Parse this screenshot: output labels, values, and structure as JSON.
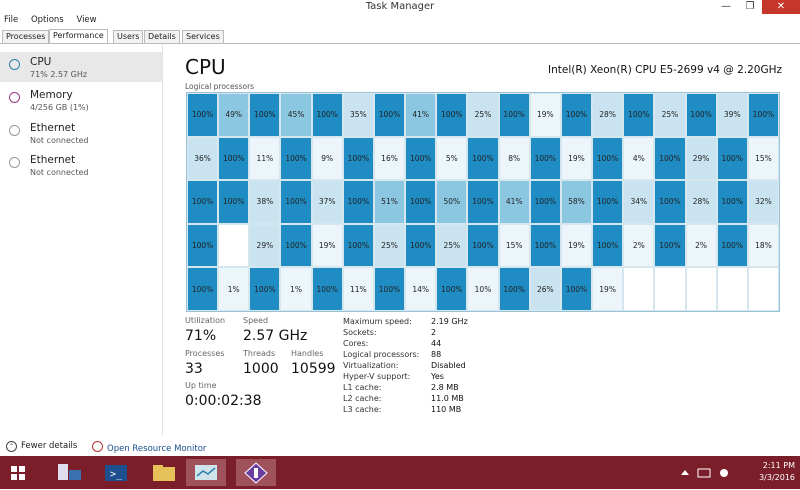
{
  "window": {
    "title": "Task Manager"
  },
  "menu": [
    "File",
    "Options",
    "View"
  ],
  "tabs": [
    "Processes",
    "Performance",
    "Users",
    "Details",
    "Services"
  ],
  "sidebar": [
    {
      "name": "CPU",
      "sub": "71%  2.57 GHz",
      "color": "#2e7fb0"
    },
    {
      "name": "Memory",
      "sub": "4/256 GB (1%)",
      "color": "#9b3a8a"
    },
    {
      "name": "Ethernet",
      "sub": "Not connected",
      "color": "#999999"
    },
    {
      "name": "Ethernet",
      "sub": "Not connected",
      "color": "#999999"
    }
  ],
  "cpu": {
    "title": "CPU",
    "model": "Intel(R) Xeon(R) CPU E5-2699 v4 @ 2.20GHz",
    "logical_label": "Logical processors",
    "cores": [
      "100%",
      "49%",
      "100%",
      "45%",
      "100%",
      "35%",
      "100%",
      "41%",
      "100%",
      "25%",
      "100%",
      "19%",
      "100%",
      "28%",
      "100%",
      "25%",
      "100%",
      "39%",
      "100%",
      "36%",
      "100%",
      "11%",
      "100%",
      "9%",
      "100%",
      "16%",
      "100%",
      "5%",
      "100%",
      "8%",
      "100%",
      "19%",
      "100%",
      "4%",
      "100%",
      "29%",
      "100%",
      "15%",
      "100%",
      "100%",
      "38%",
      "100%",
      "37%",
      "100%",
      "51%",
      "100%",
      "50%",
      "100%",
      "41%",
      "100%",
      "58%",
      "100%",
      "34%",
      "100%",
      "28%",
      "100%",
      "32%",
      "100%",
      "",
      "29%",
      "100%",
      "19%",
      "100%",
      "25%",
      "100%",
      "25%",
      "100%",
      "15%",
      "100%",
      "19%",
      "100%",
      "2%",
      "100%",
      "2%",
      "100%",
      "18%",
      "100%",
      "1%",
      "100%",
      "1%",
      "100%",
      "11%",
      "100%",
      "14%",
      "100%",
      "10%",
      "100%",
      "26%",
      "100%",
      "19%"
    ],
    "utilization_label": "Utilization",
    "utilization": "71%",
    "speed_label": "Speed",
    "speed": "2.57 GHz",
    "processes_label": "Processes",
    "processes": "33",
    "threads_label": "Threads",
    "threads": "1000",
    "handles_label": "Handles",
    "handles": "10599",
    "uptime_label": "Up time",
    "uptime": "0:00:02:38",
    "details": [
      {
        "k": "Maximum speed:",
        "v": "2.19 GHz"
      },
      {
        "k": "Sockets:",
        "v": "2"
      },
      {
        "k": "Cores:",
        "v": "44"
      },
      {
        "k": "Logical processors:",
        "v": "88"
      },
      {
        "k": "Virtualization:",
        "v": "Disabled"
      },
      {
        "k": "Hyper-V support:",
        "v": "Yes"
      },
      {
        "k": "L1 cache:",
        "v": "2.8 MB"
      },
      {
        "k": "L2 cache:",
        "v": "11.0 MB"
      },
      {
        "k": "L3 cache:",
        "v": "110 MB"
      }
    ]
  },
  "footer": {
    "fewer": "Fewer details",
    "monitor": "Open Resource Monitor"
  },
  "tray": {
    "time": "2:11 PM",
    "date": "3/3/2016"
  },
  "colors": {
    "high": "#1f8cc4",
    "low": "#ecf5fa",
    "mid": "#8cc7e2",
    "accent": "#7a1f2a"
  }
}
